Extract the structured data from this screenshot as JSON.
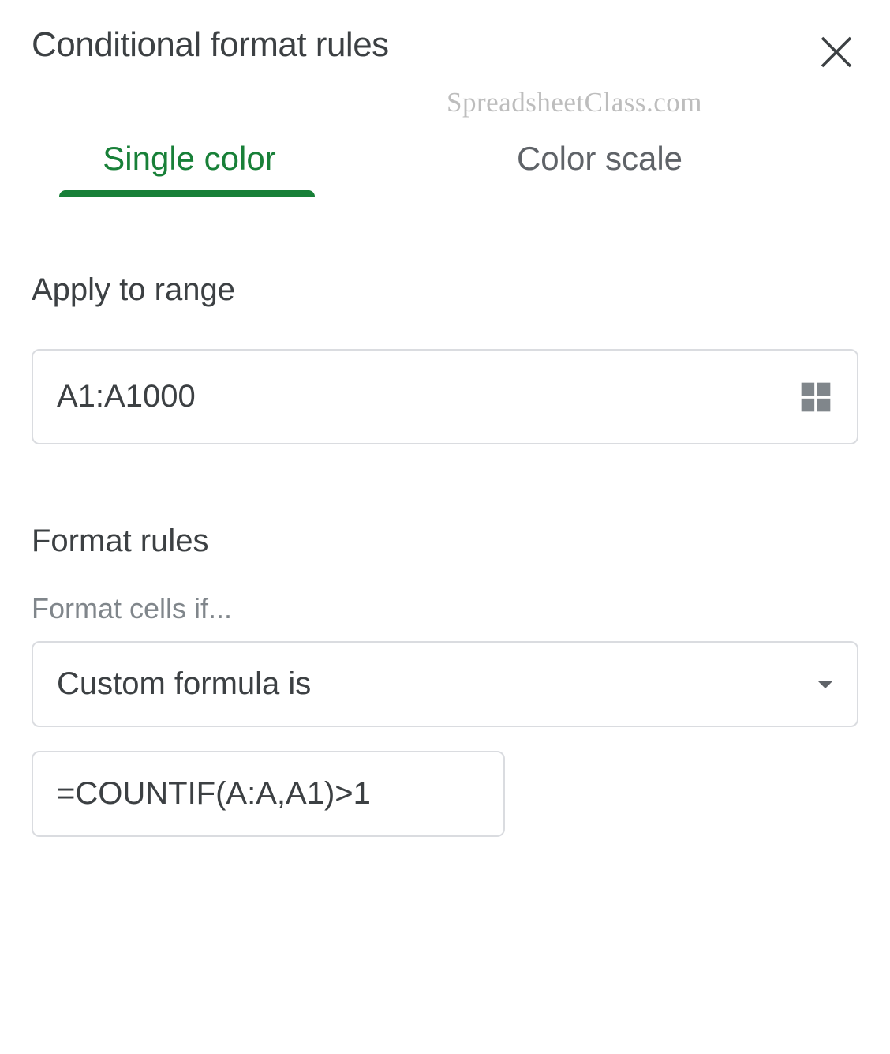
{
  "header": {
    "title": "Conditional format rules"
  },
  "watermark": "SpreadsheetClass.com",
  "tabs": {
    "single": "Single color",
    "colorScale": "Color scale"
  },
  "applyRange": {
    "label": "Apply to range",
    "value": "A1:A1000"
  },
  "formatRules": {
    "label": "Format rules",
    "subLabel": "Format cells if...",
    "ruleType": "Custom formula is",
    "formula": "=COUNTIF(A:A,A1)>1"
  }
}
